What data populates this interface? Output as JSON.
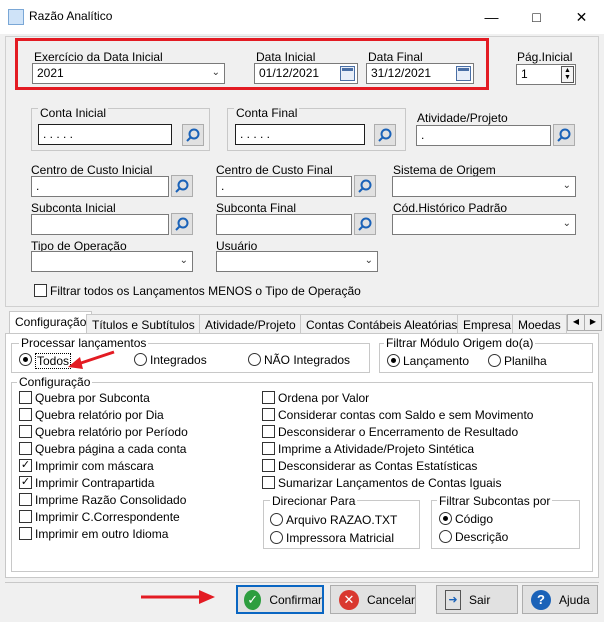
{
  "window": {
    "title": "Razão Analítico"
  },
  "colors": {
    "highlight_border": "#e31b23",
    "arrow": "#e31b23",
    "confirm_icon": "#2e9e3f",
    "cancel_icon": "#d9382f",
    "help_icon": "#1a62b8"
  },
  "header": {
    "exercicio_label": "Exercício da Data Inicial",
    "exercicio_value": "2021",
    "data_inicial_label": "Data Inicial",
    "data_inicial_value": "01/12/2021",
    "data_final_label": "Data Final",
    "data_final_value": "31/12/2021",
    "pag_inicial_label": "Pág.Inicial",
    "pag_inicial_value": "1"
  },
  "filters": {
    "conta_inicial_label": "Conta Inicial",
    "conta_inicial_value": ". . . . .",
    "conta_final_label": "Conta Final",
    "conta_final_value": ". . . . .",
    "atividade_label": "Atividade/Projeto",
    "atividade_value": ".",
    "cc_inicial_label": "Centro de Custo Inicial",
    "cc_inicial_value": ".",
    "cc_final_label": "Centro de Custo Final",
    "cc_final_value": ".",
    "sistema_origem_label": "Sistema de Origem",
    "subconta_inicial_label": "Subconta Inicial",
    "subconta_final_label": "Subconta Final",
    "cod_historico_label": "Cód.Histórico Padrão",
    "tipo_operacao_label": "Tipo de Operação",
    "usuario_label": "Usuário",
    "filtrar_todos_label": "Filtrar todos os Lançamentos MENOS o Tipo de Operação"
  },
  "tabs": [
    "Configuração",
    "Títulos e Subtítulos",
    "Atividade/Projeto",
    "Contas Contábeis Aleatórias",
    "Empresa",
    "Moedas"
  ],
  "processar": {
    "title": "Processar lançamentos",
    "options": [
      "Todos",
      "Integrados",
      "NÃO Integrados"
    ]
  },
  "modulo": {
    "title": "Filtrar Módulo Origem do(a)",
    "options": [
      "Lançamento",
      "Planilha"
    ]
  },
  "config": {
    "title": "Configuração",
    "left": [
      {
        "label": "Quebra por Subconta",
        "checked": false
      },
      {
        "label": "Quebra relatório por Dia",
        "checked": false
      },
      {
        "label": "Quebra relatório por Período",
        "checked": false
      },
      {
        "label": "Quebra página a cada conta",
        "checked": false
      },
      {
        "label": "Imprimir com máscara",
        "checked": true
      },
      {
        "label": "Imprimir Contrapartida",
        "checked": true
      },
      {
        "label": "Imprime Razão Consolidado",
        "checked": false
      },
      {
        "label": "Imprimir C.Correspondente",
        "checked": false
      },
      {
        "label": "Imprimir em outro Idioma",
        "checked": false
      }
    ],
    "right": [
      {
        "label": "Ordena por Valor",
        "checked": false
      },
      {
        "label": "Considerar contas com Saldo e sem Movimento",
        "checked": false
      },
      {
        "label": "Desconsiderar o Encerramento de Resultado",
        "checked": false
      },
      {
        "label": "Imprime a Atividade/Projeto Sintética",
        "checked": false
      },
      {
        "label": "Desconsiderar as Contas Estatísticas",
        "checked": false
      },
      {
        "label": "Sumarizar Lançamentos de Contas Iguais",
        "checked": false
      }
    ],
    "direcionar": {
      "title": "Direcionar  Para",
      "options": [
        "Arquivo RAZAO.TXT",
        "Impressora Matricial"
      ]
    },
    "subcontas": {
      "title": "Filtrar Subcontas por",
      "options": [
        "Código",
        "Descrição"
      ]
    }
  },
  "buttons": {
    "confirmar": "Confirmar",
    "cancelar": "Cancelar",
    "sair": "Sair",
    "ajuda": "Ajuda"
  }
}
